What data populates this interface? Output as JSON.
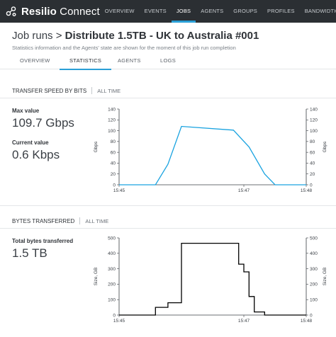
{
  "app": {
    "brand_bold": "Resilio",
    "brand_light": "Connect",
    "accent": "#2a9fd6",
    "topbar_color": "#2b2f33",
    "logo_icon": "resilio-logo-icon"
  },
  "nav": {
    "items": [
      "OVERVIEW",
      "EVENTS",
      "JOBS",
      "AGENTS",
      "GROUPS",
      "PROFILES",
      "BANDWIDTH"
    ],
    "active": "JOBS"
  },
  "page": {
    "crumb": "Job runs",
    "separator": ">",
    "title": "Distribute 1.5TB - UK to Australia #001",
    "subtitle": "Statistics information and the Agents' state are shown for the moment of this job run completion"
  },
  "tabs": {
    "items": [
      "OVERVIEW",
      "STATISTICS",
      "AGENTS",
      "LOGS"
    ],
    "active": "STATISTICS"
  },
  "transfer_speed": {
    "heading": "TRANSFER SPEED BY BITS",
    "range": "ALL TIME",
    "max_label": "Max value",
    "max_value": "109.7 Gbps",
    "current_label": "Current value",
    "current_value": "0.6 Kbps"
  },
  "bytes_transferred": {
    "heading": "BYTES TRANSFERRED",
    "range": "ALL TIME",
    "total_label": "Total bytes transferred",
    "total_value": "1.5 TB"
  },
  "chart_data": [
    {
      "type": "line",
      "title": "TRANSFER SPEED BY BITS",
      "ylabel": "Gbps",
      "y2label": "Gbps",
      "ylim": [
        0,
        140
      ],
      "yticks": [
        0,
        20,
        40,
        60,
        80,
        100,
        120,
        140
      ],
      "xlim": [
        0,
        180
      ],
      "xtick_labels": [
        "15:45",
        "15:47",
        "15:48"
      ],
      "xtick_positions": [
        0,
        120,
        180
      ],
      "x": [
        0,
        35,
        47,
        60,
        110,
        125,
        140,
        150,
        180
      ],
      "series": [
        {
          "values": [
            0,
            0,
            38,
            108,
            101,
            70,
            20,
            0,
            0
          ]
        }
      ],
      "color": "#1aa3e0",
      "grid": false
    },
    {
      "type": "line",
      "title": "BYTES TRANSFERRED",
      "ylabel": "Size, GB",
      "y2label": "Size, GB",
      "ylim": [
        0,
        500
      ],
      "yticks": [
        0,
        100,
        200,
        300,
        400,
        500
      ],
      "xlim": [
        0,
        180
      ],
      "xtick_labels": [
        "15:45",
        "15:47",
        "15:48"
      ],
      "xtick_positions": [
        0,
        120,
        180
      ],
      "step": true,
      "x": [
        0,
        35,
        47,
        60,
        110,
        115,
        120,
        125,
        130,
        140,
        180
      ],
      "series": [
        {
          "values": [
            0,
            50,
            80,
            465,
            465,
            330,
            280,
            120,
            20,
            0,
            0
          ]
        }
      ],
      "color": "#000000",
      "grid": false
    }
  ]
}
